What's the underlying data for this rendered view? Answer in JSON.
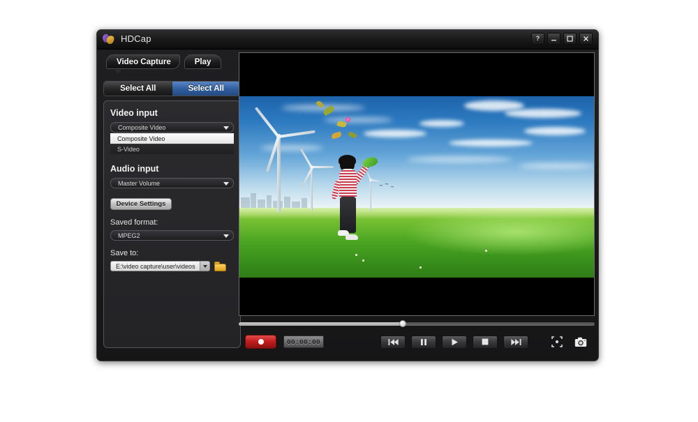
{
  "window": {
    "title": "HDCap",
    "logo_icon": "butterfly-logo-icon",
    "buttons": [
      {
        "name": "help-button",
        "glyph": "?"
      },
      {
        "name": "minimize-button",
        "glyph": "–"
      },
      {
        "name": "maximize-button",
        "glyph": "□"
      },
      {
        "name": "close-button",
        "glyph": "✕"
      }
    ]
  },
  "mode_tabs": [
    {
      "label": "Video Capture",
      "active": true
    },
    {
      "label": "Play",
      "active": false
    }
  ],
  "select_all_row": {
    "left_label": "Select All",
    "right_label": "Select All",
    "active_side": "right",
    "active_color": "#2f5e9e"
  },
  "settings": {
    "video_input": {
      "label": "Video input",
      "value": "Composite Video",
      "open": true,
      "options": [
        {
          "label": "Composite Video",
          "selected": true
        },
        {
          "label": "S-Video",
          "selected": false
        }
      ]
    },
    "audio_input": {
      "label": "Audio input",
      "value": "Master Volume",
      "options": [
        "Master Volume"
      ]
    },
    "device_settings_button": "Device Settings",
    "saved_format": {
      "label": "Saved format:",
      "value": "MPEG2",
      "options": [
        "MPEG2"
      ]
    },
    "save_to": {
      "label": "Save to:",
      "value": "E:\\video capture\\user\\videos",
      "browse_icon": "folder-icon",
      "dropdown_icon": "chevron-down-icon"
    }
  },
  "player": {
    "scrubber": {
      "progress_percent": 46
    },
    "record_button": {
      "name": "record-button",
      "icon": "record-dot-icon",
      "color": "#c21d1d"
    },
    "timer": "00:00:00",
    "transport": [
      {
        "name": "previous-button",
        "icon": "skip-previous-icon"
      },
      {
        "name": "pause-button",
        "icon": "pause-icon"
      },
      {
        "name": "play-button",
        "icon": "play-icon"
      },
      {
        "name": "stop-button",
        "icon": "stop-icon"
      },
      {
        "name": "next-button",
        "icon": "skip-next-icon"
      }
    ],
    "fullscreen_icon": "fullscreen-icon",
    "snapshot_icon": "camera-icon"
  }
}
